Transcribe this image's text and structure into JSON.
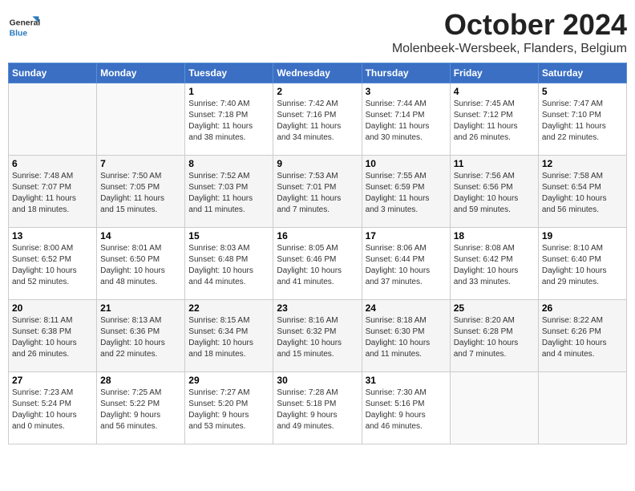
{
  "header": {
    "logo_general": "General",
    "logo_blue": "Blue",
    "month": "October 2024",
    "location": "Molenbeek-Wersbeek, Flanders, Belgium"
  },
  "days_of_week": [
    "Sunday",
    "Monday",
    "Tuesday",
    "Wednesday",
    "Thursday",
    "Friday",
    "Saturday"
  ],
  "weeks": [
    [
      {
        "num": "",
        "info": ""
      },
      {
        "num": "",
        "info": ""
      },
      {
        "num": "1",
        "info": "Sunrise: 7:40 AM\nSunset: 7:18 PM\nDaylight: 11 hours\nand 38 minutes."
      },
      {
        "num": "2",
        "info": "Sunrise: 7:42 AM\nSunset: 7:16 PM\nDaylight: 11 hours\nand 34 minutes."
      },
      {
        "num": "3",
        "info": "Sunrise: 7:44 AM\nSunset: 7:14 PM\nDaylight: 11 hours\nand 30 minutes."
      },
      {
        "num": "4",
        "info": "Sunrise: 7:45 AM\nSunset: 7:12 PM\nDaylight: 11 hours\nand 26 minutes."
      },
      {
        "num": "5",
        "info": "Sunrise: 7:47 AM\nSunset: 7:10 PM\nDaylight: 11 hours\nand 22 minutes."
      }
    ],
    [
      {
        "num": "6",
        "info": "Sunrise: 7:48 AM\nSunset: 7:07 PM\nDaylight: 11 hours\nand 18 minutes."
      },
      {
        "num": "7",
        "info": "Sunrise: 7:50 AM\nSunset: 7:05 PM\nDaylight: 11 hours\nand 15 minutes."
      },
      {
        "num": "8",
        "info": "Sunrise: 7:52 AM\nSunset: 7:03 PM\nDaylight: 11 hours\nand 11 minutes."
      },
      {
        "num": "9",
        "info": "Sunrise: 7:53 AM\nSunset: 7:01 PM\nDaylight: 11 hours\nand 7 minutes."
      },
      {
        "num": "10",
        "info": "Sunrise: 7:55 AM\nSunset: 6:59 PM\nDaylight: 11 hours\nand 3 minutes."
      },
      {
        "num": "11",
        "info": "Sunrise: 7:56 AM\nSunset: 6:56 PM\nDaylight: 10 hours\nand 59 minutes."
      },
      {
        "num": "12",
        "info": "Sunrise: 7:58 AM\nSunset: 6:54 PM\nDaylight: 10 hours\nand 56 minutes."
      }
    ],
    [
      {
        "num": "13",
        "info": "Sunrise: 8:00 AM\nSunset: 6:52 PM\nDaylight: 10 hours\nand 52 minutes."
      },
      {
        "num": "14",
        "info": "Sunrise: 8:01 AM\nSunset: 6:50 PM\nDaylight: 10 hours\nand 48 minutes."
      },
      {
        "num": "15",
        "info": "Sunrise: 8:03 AM\nSunset: 6:48 PM\nDaylight: 10 hours\nand 44 minutes."
      },
      {
        "num": "16",
        "info": "Sunrise: 8:05 AM\nSunset: 6:46 PM\nDaylight: 10 hours\nand 41 minutes."
      },
      {
        "num": "17",
        "info": "Sunrise: 8:06 AM\nSunset: 6:44 PM\nDaylight: 10 hours\nand 37 minutes."
      },
      {
        "num": "18",
        "info": "Sunrise: 8:08 AM\nSunset: 6:42 PM\nDaylight: 10 hours\nand 33 minutes."
      },
      {
        "num": "19",
        "info": "Sunrise: 8:10 AM\nSunset: 6:40 PM\nDaylight: 10 hours\nand 29 minutes."
      }
    ],
    [
      {
        "num": "20",
        "info": "Sunrise: 8:11 AM\nSunset: 6:38 PM\nDaylight: 10 hours\nand 26 minutes."
      },
      {
        "num": "21",
        "info": "Sunrise: 8:13 AM\nSunset: 6:36 PM\nDaylight: 10 hours\nand 22 minutes."
      },
      {
        "num": "22",
        "info": "Sunrise: 8:15 AM\nSunset: 6:34 PM\nDaylight: 10 hours\nand 18 minutes."
      },
      {
        "num": "23",
        "info": "Sunrise: 8:16 AM\nSunset: 6:32 PM\nDaylight: 10 hours\nand 15 minutes."
      },
      {
        "num": "24",
        "info": "Sunrise: 8:18 AM\nSunset: 6:30 PM\nDaylight: 10 hours\nand 11 minutes."
      },
      {
        "num": "25",
        "info": "Sunrise: 8:20 AM\nSunset: 6:28 PM\nDaylight: 10 hours\nand 7 minutes."
      },
      {
        "num": "26",
        "info": "Sunrise: 8:22 AM\nSunset: 6:26 PM\nDaylight: 10 hours\nand 4 minutes."
      }
    ],
    [
      {
        "num": "27",
        "info": "Sunrise: 7:23 AM\nSunset: 5:24 PM\nDaylight: 10 hours\nand 0 minutes."
      },
      {
        "num": "28",
        "info": "Sunrise: 7:25 AM\nSunset: 5:22 PM\nDaylight: 9 hours\nand 56 minutes."
      },
      {
        "num": "29",
        "info": "Sunrise: 7:27 AM\nSunset: 5:20 PM\nDaylight: 9 hours\nand 53 minutes."
      },
      {
        "num": "30",
        "info": "Sunrise: 7:28 AM\nSunset: 5:18 PM\nDaylight: 9 hours\nand 49 minutes."
      },
      {
        "num": "31",
        "info": "Sunrise: 7:30 AM\nSunset: 5:16 PM\nDaylight: 9 hours\nand 46 minutes."
      },
      {
        "num": "",
        "info": ""
      },
      {
        "num": "",
        "info": ""
      }
    ]
  ]
}
